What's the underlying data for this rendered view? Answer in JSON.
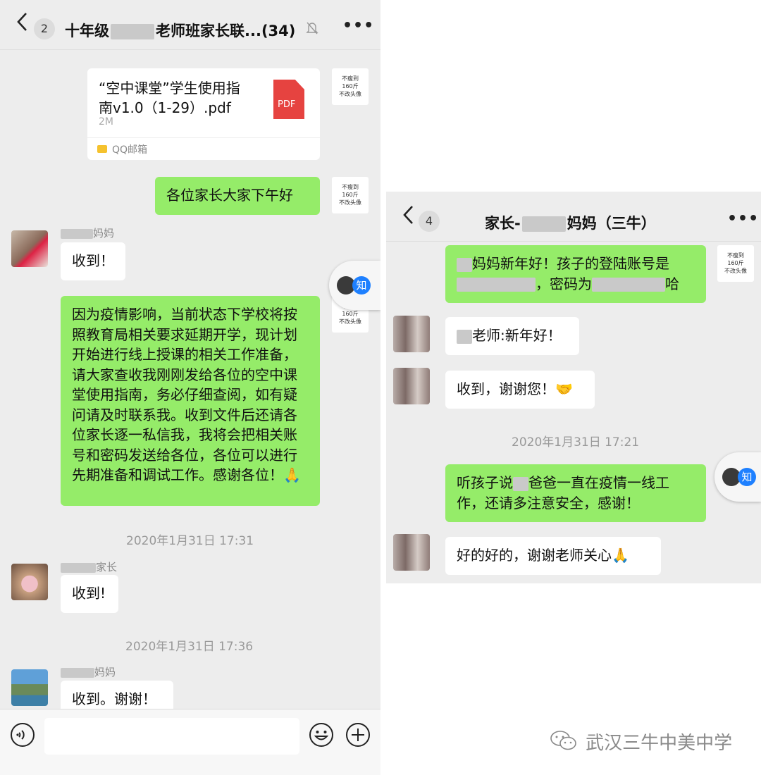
{
  "left_chat": {
    "header": {
      "back_count": "2",
      "title_prefix": "十年级",
      "title_suffix": "老师班家长联...",
      "member_count": "(34)",
      "more": "•••"
    },
    "file_card": {
      "name_line1": "“空中课堂”学生使用指",
      "name_line2": "南v1.0（1-29）.pdf",
      "size": "2M",
      "file_icon": "PDF",
      "source": "QQ邮箱"
    },
    "sticker": {
      "line1": "不瘦到",
      "line2": "160斤",
      "line3": "不改头像"
    },
    "messages": {
      "greeting": "各位家长大家下午好",
      "reply1_sender": "妈妈",
      "reply1": "收到！",
      "notice": "因为疫情影响，当前状态下学校将按照教育局相关要求延期开学，现计划开始进行线上授课的相关工作准备，请大家查收我刚刚发给各位的空中课堂使用指南，务必仔细查阅，如有疑问请及时联系我。收到文件后还请各位家长逐一私信我，我将会把相关账号和密码发送给各位，各位可以进行先期准备和调试工作。感谢各位！",
      "notice_emoji": "🙏",
      "time1": "2020年1月31日 17:31",
      "reply2_sender": "家长",
      "reply2": "收到!",
      "time2": "2020年1月31日 17:36",
      "reply3_sender": "妈妈",
      "reply3": "收到。谢谢！"
    },
    "float_badge": "知"
  },
  "right_chat": {
    "header": {
      "back_count": "4",
      "title_prefix": "家长-",
      "title_suffix": "妈妈（三牛）",
      "more": "•••"
    },
    "messages": {
      "m1_a": "妈妈新年好！孩子的登陆账号是",
      "m1_b": "，密码为",
      "m1_c": "哈",
      "m2": "老师:新年好！",
      "m3": "收到，谢谢您！",
      "m3_emoji": "🤝",
      "time": "2020年1月31日 17:21",
      "m4_a": "听孩子说",
      "m4_b": "爸爸一直在疫情一线工",
      "m4_c": "作，还请多注意安全，感谢！",
      "m5": "好的好的，谢谢老师关心",
      "m5_emoji": "🙏"
    },
    "float_badge": "知"
  },
  "watermark": "武汉三牛中美中学",
  "colors": {
    "bubble_green": "#95ec69",
    "chat_bg": "#ededed",
    "badge_blue": "#1e80ff"
  }
}
